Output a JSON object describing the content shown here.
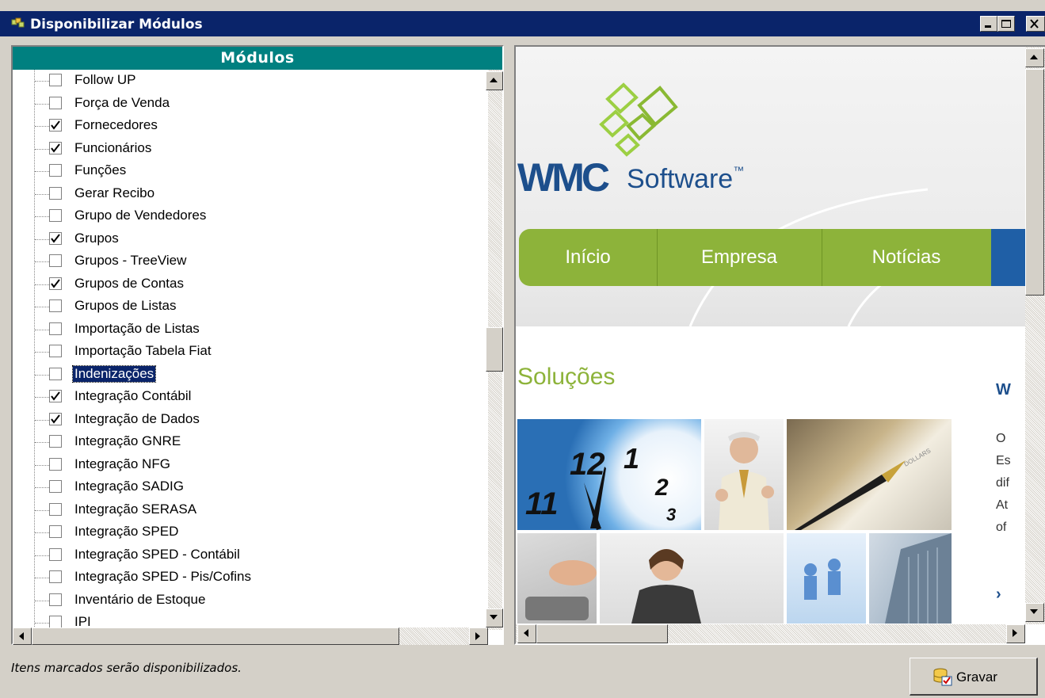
{
  "window": {
    "title": "Disponibilizar Módulos"
  },
  "left": {
    "header": "Módulos",
    "items": [
      {
        "label": "Follow UP",
        "checked": false
      },
      {
        "label": "Força de Venda",
        "checked": false
      },
      {
        "label": "Fornecedores",
        "checked": true
      },
      {
        "label": "Funcionários",
        "checked": true
      },
      {
        "label": "Funções",
        "checked": false
      },
      {
        "label": "Gerar Recibo",
        "checked": false
      },
      {
        "label": "Grupo de Vendedores",
        "checked": false
      },
      {
        "label": "Grupos",
        "checked": true
      },
      {
        "label": "Grupos - TreeView",
        "checked": false
      },
      {
        "label": "Grupos de Contas",
        "checked": true
      },
      {
        "label": "Grupos de Listas",
        "checked": false
      },
      {
        "label": "Importação de Listas",
        "checked": false
      },
      {
        "label": "Importação Tabela Fiat",
        "checked": false
      },
      {
        "label": "Indenizações",
        "checked": false,
        "selected": true
      },
      {
        "label": "Integração Contábil",
        "checked": true
      },
      {
        "label": "Integração de Dados",
        "checked": true
      },
      {
        "label": "Integração GNRE",
        "checked": false
      },
      {
        "label": "Integração NFG",
        "checked": false
      },
      {
        "label": "Integração SADIG",
        "checked": false
      },
      {
        "label": "Integração SERASA",
        "checked": false
      },
      {
        "label": "Integração SPED",
        "checked": false
      },
      {
        "label": "Integração SPED - Contábil",
        "checked": false
      },
      {
        "label": "Integração SPED - Pis/Cofins",
        "checked": false
      },
      {
        "label": "Inventário de Estoque",
        "checked": false
      },
      {
        "label": "IPI",
        "checked": false
      }
    ]
  },
  "web": {
    "logo_wmc": "WMC",
    "logo_software": "Software",
    "logo_tm": "™",
    "nav": [
      "Início",
      "Empresa",
      "Notícias"
    ],
    "solucoes": "Soluções",
    "side_heading": "W",
    "side_lines": [
      "O",
      "Es",
      "dif",
      "At",
      "of"
    ],
    "side_arrow": "›",
    "clock_digits": [
      "11",
      "12",
      "1",
      "2",
      "3"
    ],
    "pen_text": "DOLLARS"
  },
  "status": {
    "text": "Itens marcados serão disponibilizados."
  },
  "buttons": {
    "gravar": "Gravar"
  },
  "colors": {
    "titlebar": "#0a246a",
    "header": "#008080",
    "accent_green": "#8db33a",
    "nav_blue": "#1f5fa6"
  }
}
